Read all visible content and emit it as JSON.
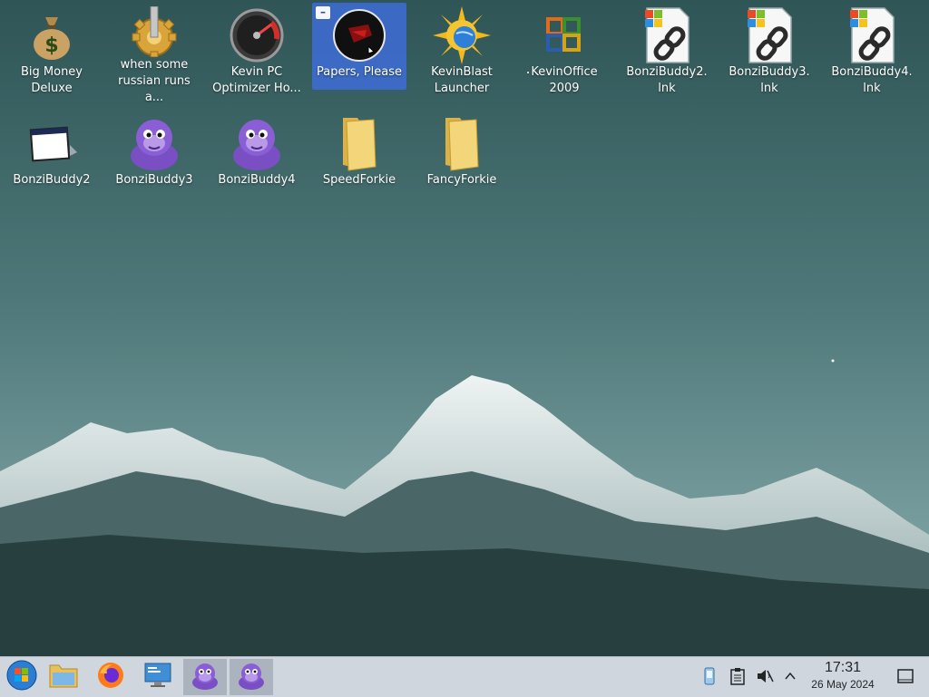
{
  "desktop": {
    "icons": [
      {
        "label": "Big Money\nDeluxe",
        "icon": "money-bag-icon"
      },
      {
        "label": "when some\nrussian runs a...",
        "icon": "gear-icon"
      },
      {
        "label": "Kevin PC\nOptimizer Ho...",
        "icon": "speedometer-icon"
      },
      {
        "label": "Papers, Please",
        "icon": "papers-please-icon"
      },
      {
        "label": "KevinBlast\nLauncher",
        "icon": "sun-globe-icon"
      },
      {
        "label": "KevinOffice\n2009",
        "icon": "office-icon"
      },
      {
        "label": "BonziBuddy2.\nlnk",
        "icon": "shortcut-file-icon"
      },
      {
        "label": "BonziBuddy3.\nlnk",
        "icon": "shortcut-file-icon"
      },
      {
        "label": "BonziBuddy4.\nlnk",
        "icon": "shortcut-file-icon"
      },
      {
        "label": "BonziBuddy2",
        "icon": "app-window-icon"
      },
      {
        "label": "BonziBuddy3",
        "icon": "purple-gorilla-icon"
      },
      {
        "label": "BonziBuddy4",
        "icon": "purple-gorilla-icon"
      },
      {
        "label": "SpeedForkie",
        "icon": "folder-icon"
      },
      {
        "label": "FancyForkie",
        "icon": "folder-icon"
      }
    ],
    "selected_badge": "–"
  },
  "taskbar": {
    "buttons": [
      {
        "name": "start-button",
        "icon": "windows-logo-icon"
      },
      {
        "name": "file-manager-button",
        "icon": "folder-icon"
      },
      {
        "name": "firefox-button",
        "icon": "firefox-icon"
      },
      {
        "name": "system-settings-button",
        "icon": "monitor-icon"
      },
      {
        "name": "bonzibuddy-task-1",
        "icon": "purple-gorilla-icon"
      },
      {
        "name": "bonzibuddy-task-2",
        "icon": "purple-gorilla-icon"
      }
    ],
    "tray": [
      "network-icon",
      "clipboard-icon",
      "muted-speaker-icon",
      "chevron-up-icon"
    ],
    "clock": {
      "time": "17:31",
      "date": "26 May 2024"
    }
  },
  "colors": {
    "selection": "#3d6cd6",
    "taskbar": "#cfd6de",
    "sky_top": "#2f5556",
    "sky_bottom": "#8fb1b3"
  }
}
